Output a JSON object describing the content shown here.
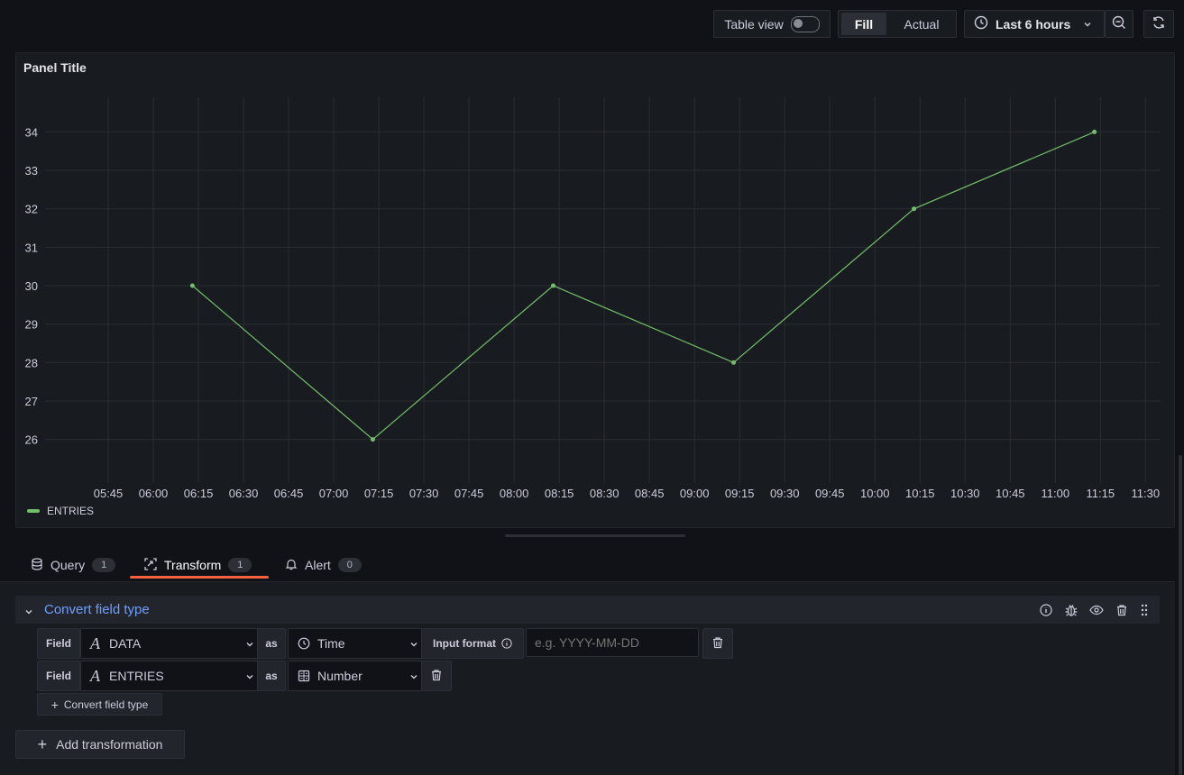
{
  "toolbar": {
    "table_view_label": "Table view",
    "fill_label": "Fill",
    "actual_label": "Actual",
    "time_range_label": "Last 6 hours"
  },
  "panel": {
    "title": "Panel Title"
  },
  "chart_data": {
    "type": "line",
    "x": [
      "06:13",
      "07:13",
      "08:13",
      "09:13",
      "10:13",
      "11:13"
    ],
    "series": [
      {
        "name": "ENTRIES",
        "values": [
          30,
          26,
          30,
          28,
          32,
          34
        ],
        "color": "#73bf69"
      }
    ],
    "x_tick_labels": [
      "05:45",
      "06:00",
      "06:15",
      "06:30",
      "06:45",
      "07:00",
      "07:15",
      "07:30",
      "07:45",
      "08:00",
      "08:15",
      "08:30",
      "08:45",
      "09:00",
      "09:15",
      "09:30",
      "09:45",
      "10:00",
      "10:15",
      "10:30",
      "10:45",
      "11:00",
      "11:15",
      "11:30"
    ],
    "y_tick_labels": [
      "26",
      "27",
      "28",
      "29",
      "30",
      "31",
      "32",
      "33",
      "34"
    ],
    "ylim": [
      25.1,
      34.9
    ],
    "grid": true,
    "legend": "bottom-left"
  },
  "tabs": [
    {
      "label": "Query",
      "count": "1",
      "icon": "database-icon"
    },
    {
      "label": "Transform",
      "count": "1",
      "icon": "transform-icon",
      "active": true
    },
    {
      "label": "Alert",
      "count": "0",
      "icon": "bell-icon"
    }
  ],
  "transformation": {
    "title": "Convert field type",
    "rows": [
      {
        "field_label": "Field",
        "field_value": "DATA",
        "as_label": "as",
        "type_value": "Time",
        "input_format_label": "Input format",
        "input_format_placeholder": "e.g. YYYY-MM-DD"
      },
      {
        "field_label": "Field",
        "field_value": "ENTRIES",
        "as_label": "as",
        "type_value": "Number"
      }
    ],
    "add_row_label": "Convert field type"
  },
  "add_transformation_label": "Add transformation",
  "colors": {
    "accent_blue": "#6e9fff",
    "active_tab_underline": "#f55f3e",
    "series_green": "#73bf69"
  }
}
